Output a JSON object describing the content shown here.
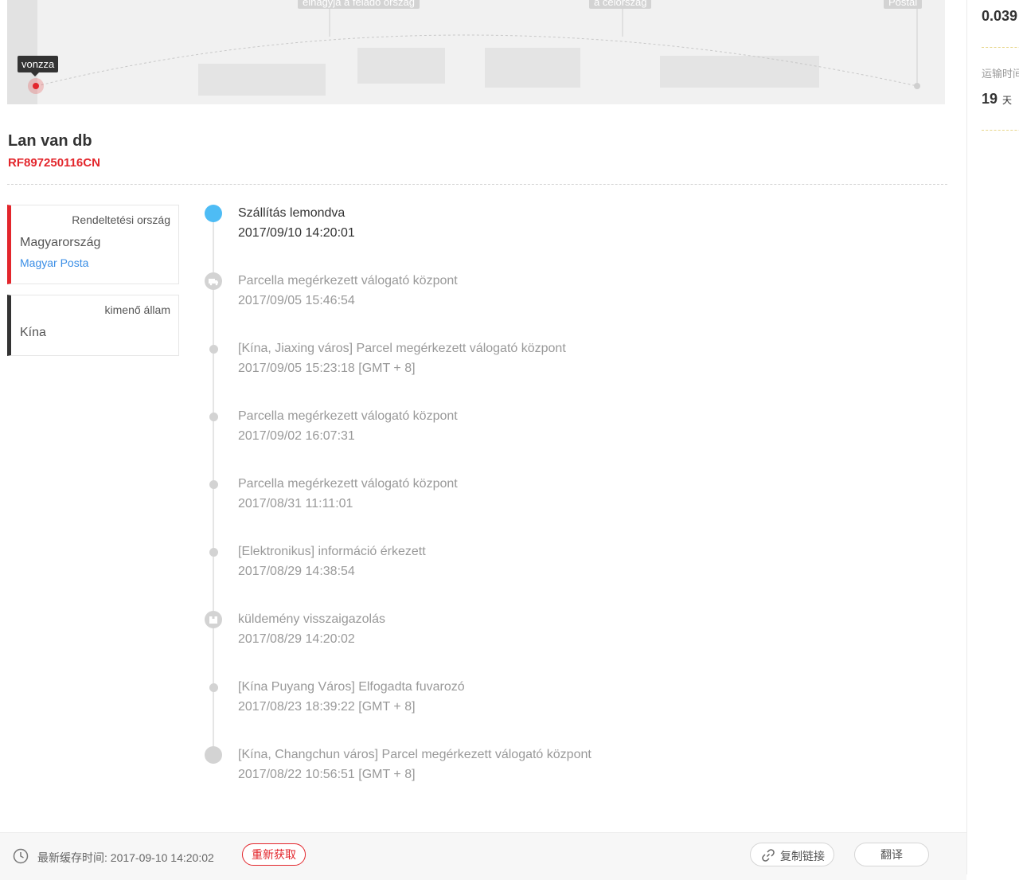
{
  "map": {
    "tags": [
      "elhagyja a feladó ország",
      "a célország",
      "Postai"
    ],
    "tooltip": "vonzza"
  },
  "right_panel": {
    "value1": "0.039",
    "label": "运输时间",
    "value2": "19",
    "unit": "天"
  },
  "package": {
    "title": "Lan van db",
    "number": "RF897250116CN"
  },
  "destination_card": {
    "label": "Rendeltetési ország",
    "country": "Magyarország",
    "carrier": "Magyar Posta"
  },
  "origin_card": {
    "label": "kimenő állam",
    "country": "Kína"
  },
  "events": [
    {
      "desc": "Szállítás lemondva",
      "time": "2017/09/10 14:20:01",
      "marker": "current"
    },
    {
      "desc": "Parcella megérkezett válogató központ",
      "time": "2017/09/05 15:46:54",
      "marker": "truck-icon"
    },
    {
      "desc": "[Kína, Jiaxing város] Parcel megérkezett válogató központ",
      "time": "2017/09/05 15:23:18 [GMT + 8]",
      "marker": "dot"
    },
    {
      "desc": "Parcella megérkezett válogató központ",
      "time": "2017/09/02 16:07:31",
      "marker": "dot"
    },
    {
      "desc": "Parcella megérkezett válogató központ",
      "time": "2017/08/31 11:11:01",
      "marker": "dot"
    },
    {
      "desc": "[Elektronikus] információ érkezett",
      "time": "2017/08/29 14:38:54",
      "marker": "dot"
    },
    {
      "desc": "küldemény visszaigazolás",
      "time": "2017/08/29 14:20:02",
      "marker": "box-icon"
    },
    {
      "desc": "[Kína Puyang Város] Elfogadta fuvarozó",
      "time": "2017/08/23 18:39:22 [GMT + 8]",
      "marker": "dot"
    },
    {
      "desc": "[Kína, Changchun város] Parcel megérkezett válogató központ",
      "time": "2017/08/22 10:56:51 [GMT + 8]",
      "marker": "start"
    }
  ],
  "footer": {
    "cache_text": "最新缓存时间: 2017-09-10 14:20:02",
    "refetch_label": "重新获取",
    "copy_label": "复制链接",
    "translate_label": "翻译"
  },
  "colors": {
    "accent_red": "#e3262c",
    "current_blue": "#4ebcf5",
    "link_blue": "#3a8ee6"
  }
}
